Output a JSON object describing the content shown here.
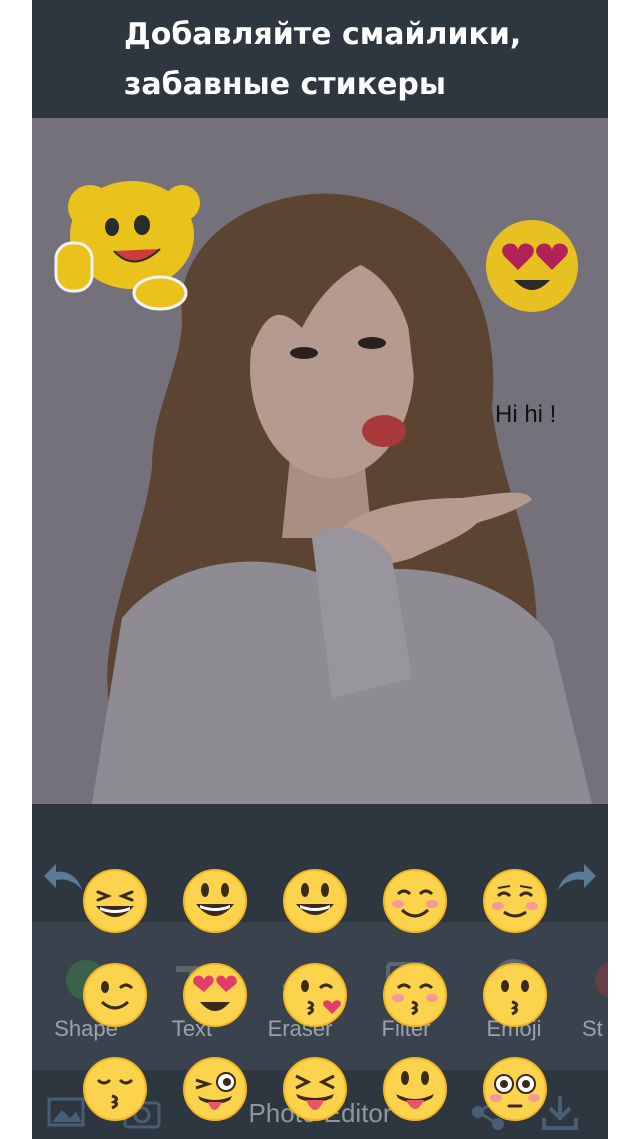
{
  "banner": {
    "title": "Добавляйте смайлики, забавные стикеры"
  },
  "canvas": {
    "text_sticker": "Hi hi !",
    "stickers": [
      {
        "name": "cartoon-baby-sticker"
      },
      {
        "name": "heart-eyes-emoji-sticker"
      }
    ]
  },
  "toolbar": {
    "tools": [
      {
        "label": "Shape",
        "icon": "circle-shape-icon"
      },
      {
        "label": "Text",
        "icon": "text-icon"
      },
      {
        "label": "Eraser",
        "icon": "eraser-icon"
      },
      {
        "label": "Filter",
        "icon": "filter-icon"
      },
      {
        "label": "Emoji",
        "icon": "emoji-icon"
      },
      {
        "label": "St",
        "icon": "sticker-icon"
      }
    ]
  },
  "bottom_bar": {
    "title": "Photo Editor"
  },
  "emoji_picker": {
    "rows": [
      [
        "grinning-squinting",
        "grinning",
        "grinning-big-eyes",
        "smiling-blush",
        "smiling-relaxed"
      ],
      [
        "winking",
        "heart-eyes",
        "kissing-heart",
        "kissing-smiling-eyes",
        "kissing"
      ],
      [
        "kissing-closed-eyes",
        "winking-tongue",
        "squinting-tongue",
        "tongue-out",
        "flushed"
      ]
    ]
  },
  "colors": {
    "background": "#2e3640",
    "tool_strip": "#3a434d",
    "emoji_yellow": "#fcd34d"
  }
}
